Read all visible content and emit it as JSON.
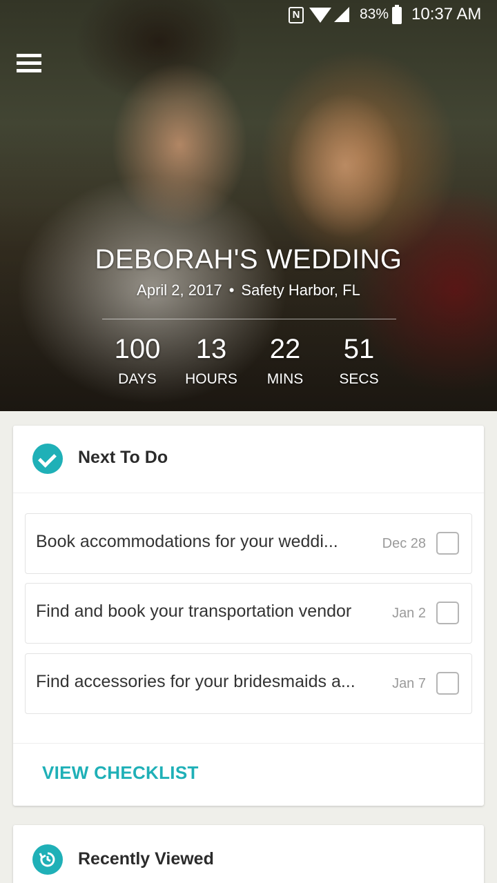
{
  "status_bar": {
    "nfc": "N",
    "battery": "83%",
    "time": "10:37 AM"
  },
  "hero": {
    "title": "DEBORAH'S WEDDING",
    "date": "April 2, 2017",
    "separator": "•",
    "location": "Safety Harbor, FL",
    "countdown": [
      {
        "value": "100",
        "unit": "DAYS"
      },
      {
        "value": "13",
        "unit": "HOURS"
      },
      {
        "value": "22",
        "unit": "MINS"
      },
      {
        "value": "51",
        "unit": "SECS"
      }
    ]
  },
  "next_to_do": {
    "title": "Next To Do",
    "tasks": [
      {
        "text": "Book accommodations for your weddi...",
        "date": "Dec 28"
      },
      {
        "text": "Find and book your transportation vendor",
        "date": "Jan 2"
      },
      {
        "text": "Find accessories for your bridesmaids a...",
        "date": "Jan 7"
      }
    ],
    "action": "VIEW CHECKLIST"
  },
  "recently_viewed": {
    "title": "Recently Viewed"
  },
  "colors": {
    "accent": "#1fb0b7",
    "background": "#efefea"
  }
}
